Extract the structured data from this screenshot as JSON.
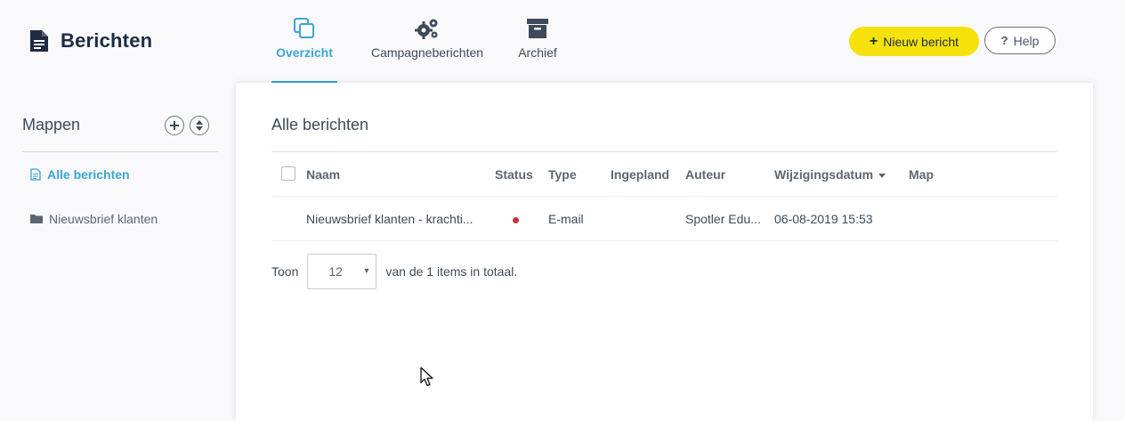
{
  "header": {
    "title": "Berichten",
    "tabs": [
      {
        "label": "Overzicht",
        "icon": "copy-icon",
        "active": true
      },
      {
        "label": "Campagneberichten",
        "icon": "gears-icon",
        "active": false
      },
      {
        "label": "Archief",
        "icon": "archive-box-icon",
        "active": false
      }
    ],
    "new_button": "Nieuw bericht",
    "help_button": "Help"
  },
  "sidebar": {
    "title": "Mappen",
    "items": [
      {
        "label": "Alle berichten",
        "icon": "document-icon",
        "active": true
      },
      {
        "label": "Nieuwsbrief klanten",
        "icon": "folder-icon",
        "active": false
      }
    ]
  },
  "main": {
    "title": "Alle berichten",
    "columns": [
      "Naam",
      "Status",
      "Type",
      "Ingepland",
      "Auteur",
      "Wijzigingsdatum",
      "Map"
    ],
    "rows": [
      {
        "naam": "Nieuwsbrief klanten - krachti...",
        "status": "status-dot",
        "type": "E-mail",
        "ingepland": "",
        "auteur": "Spotler Edu...",
        "wijzigingsdatum": "06-08-2019 15:53",
        "map": ""
      }
    ],
    "pager": {
      "prefix": "Toon",
      "per_page": "12",
      "suffix": "van de 1 items in totaal."
    }
  },
  "colors": {
    "accent": "#3aa6d5",
    "primary_button": "#f5e20d",
    "status_dot": "#c9303a"
  }
}
